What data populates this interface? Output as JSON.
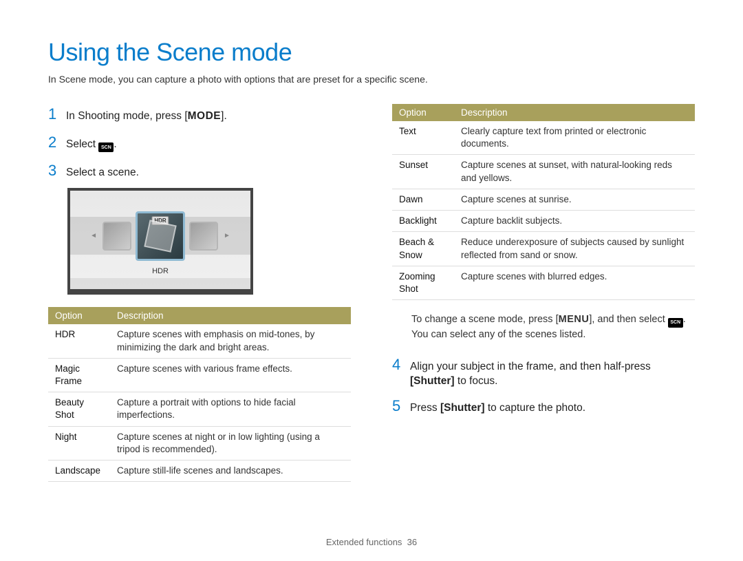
{
  "title": "Using the Scene mode",
  "intro": "In Scene mode, you can capture a photo with options that are preset for a specific scene.",
  "scn_icon_text": "SCN",
  "steps": {
    "s1_pre": "In Shooting mode, press [",
    "s1_post": "].",
    "s2_pre": "Select ",
    "s2_post": ".",
    "s3": "Select a scene.",
    "s4_a": "Align your subject in the frame, and then half-press ",
    "s4_b": "[Shutter]",
    "s4_c": " to focus.",
    "s5_a": "Press ",
    "s5_b": "[Shutter]",
    "s5_c": " to capture the photo."
  },
  "lcd": {
    "hdr_tag": "HDR",
    "caption": "HDR"
  },
  "table_headers": {
    "opt": "Option",
    "desc": "Description"
  },
  "table1": [
    {
      "opt": "HDR",
      "desc": "Capture scenes with emphasis on mid-tones, by minimizing the dark and bright areas."
    },
    {
      "opt": "Magic Frame",
      "desc": "Capture scenes with various frame effects."
    },
    {
      "opt": "Beauty Shot",
      "desc": "Capture a portrait with options to hide facial imperfections."
    },
    {
      "opt": "Night",
      "desc": "Capture scenes at night or in low lighting (using a tripod is recommended)."
    },
    {
      "opt": "Landscape",
      "desc": "Capture still-life scenes and landscapes."
    }
  ],
  "table2": [
    {
      "opt": "Text",
      "desc": "Clearly capture text from printed or electronic documents."
    },
    {
      "opt": "Sunset",
      "desc": "Capture scenes at sunset, with natural-looking reds and yellows."
    },
    {
      "opt": "Dawn",
      "desc": "Capture scenes at sunrise."
    },
    {
      "opt": "Backlight",
      "desc": "Capture backlit subjects."
    },
    {
      "opt": "Beach & Snow",
      "desc": "Reduce underexposure of subjects caused by sunlight reflected from sand or snow."
    },
    {
      "opt": "Zooming Shot",
      "desc": "Capture scenes with blurred edges."
    }
  ],
  "note": {
    "a": "To change a scene mode, press [",
    "b": "], and then select ",
    "c": ". You can select any of the scenes listed."
  },
  "footer": {
    "section": "Extended functions",
    "page": "36"
  }
}
